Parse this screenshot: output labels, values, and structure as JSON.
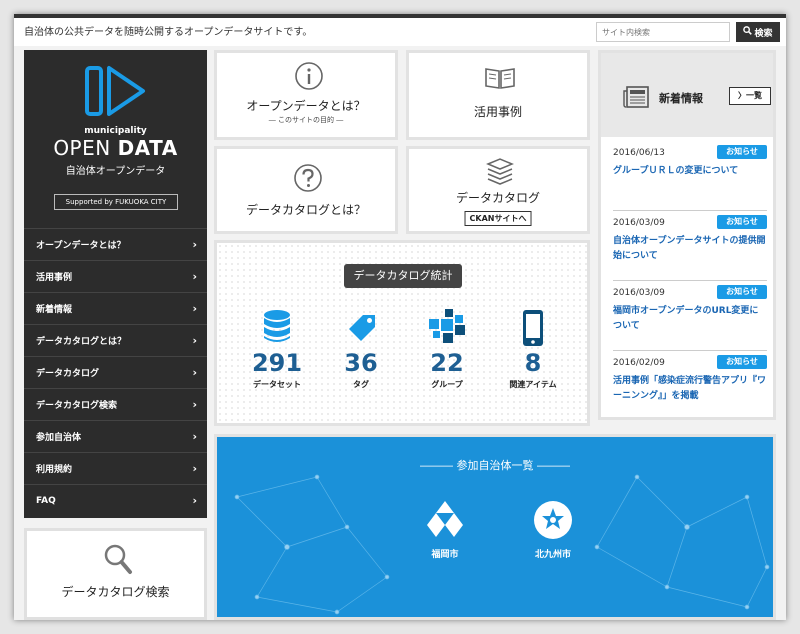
{
  "header": {
    "tagline": "自治体の公共データを随時公開するオープンデータサイトです。",
    "search_placeholder": "サイト内検索",
    "search_button": "検索"
  },
  "brand": {
    "small": "municipality",
    "big_a": "OPEN",
    "big_b": "DATA",
    "jp": "自治体オープンデータ",
    "supported": "Supported by FUKUOKA CITY"
  },
  "nav": [
    {
      "label": "オープンデータとは？"
    },
    {
      "label": "活用事例"
    },
    {
      "label": "新着情報"
    },
    {
      "label": "データカタログとは？"
    },
    {
      "label": "データカタログ"
    },
    {
      "label": "データカタログ検索"
    },
    {
      "label": "参加自治体"
    },
    {
      "label": "利用規約"
    },
    {
      "label": "FAQ"
    }
  ],
  "tiles": {
    "about_title": "オープンデータとは？",
    "about_sub": "― このサイトの目的 ―",
    "cases_title": "活用事例",
    "catalog_about_title": "データカタログとは？",
    "catalog_title": "データカタログ",
    "ckan_label": "CKANサイトへ",
    "search_title": "データカタログ検索"
  },
  "stats": {
    "title": "データカタログ統計",
    "items": [
      {
        "value": "291",
        "label": "データセット",
        "icon": "database-icon"
      },
      {
        "value": "36",
        "label": "タグ",
        "icon": "tag-icon"
      },
      {
        "value": "22",
        "label": "グループ",
        "icon": "group-icon"
      },
      {
        "value": "8",
        "label": "関連アイテム",
        "icon": "smartphone-icon"
      }
    ]
  },
  "news": {
    "title": "新着情報",
    "all_label": "〉一覧",
    "items": [
      {
        "date": "2016/06/13",
        "badge": "お知らせ",
        "text": "グループＵＲＬの変更について"
      },
      {
        "date": "2016/03/09",
        "badge": "お知らせ",
        "text": "自治体オープンデータサイトの提供開始について"
      },
      {
        "date": "2016/03/09",
        "badge": "お知らせ",
        "text": "福岡市オープンデータのURL変更について"
      },
      {
        "date": "2016/02/09",
        "badge": "お知らせ",
        "text": "活用事例「感染症流行警告アプリ『ワーニンング』」を掲載"
      }
    ]
  },
  "municipalities": {
    "title": "―――  参加自治体一覧  ―――",
    "items": [
      {
        "name": "福岡市",
        "icon": "fukuoka-emblem-icon"
      },
      {
        "name": "北九州市",
        "icon": "kitakyushu-emblem-icon"
      }
    ]
  },
  "colors": {
    "accent": "#1a9be6",
    "stat_number": "#1e5f93",
    "sidebar": "#2c2c2c",
    "muni_bg": "#1b91d9"
  }
}
